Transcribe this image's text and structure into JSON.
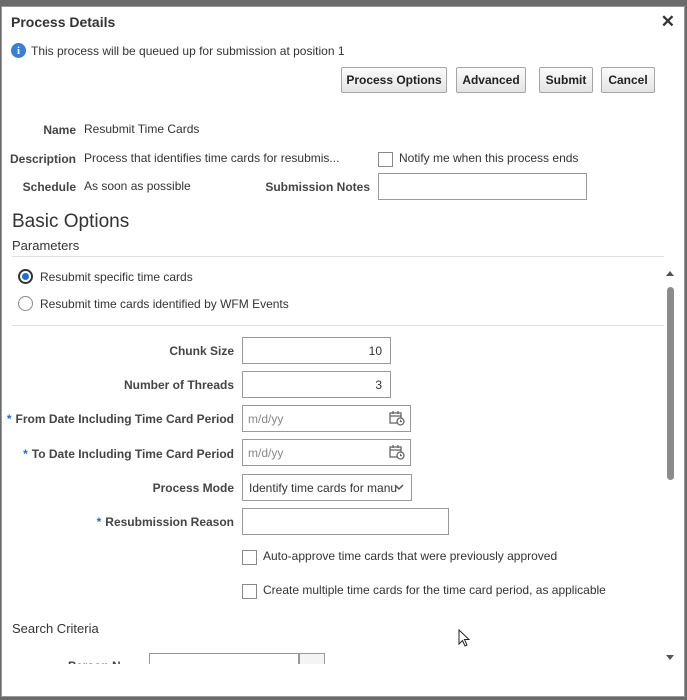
{
  "dialog": {
    "title": "Process Details",
    "close_glyph": "✕"
  },
  "info": {
    "icon_glyph": "i",
    "message": "This process will be queued up for submission at position 1"
  },
  "buttons": {
    "process_options": "Process Options",
    "advanced": "Advanced",
    "submit": "Submit",
    "cancel": "Cancel"
  },
  "details": {
    "name_label": "Name",
    "name_value": "Resubmit Time Cards",
    "description_label": "Description",
    "description_value": "Process that identifies time cards for resubmis...",
    "notify_label": "Notify me when this process ends",
    "schedule_label": "Schedule",
    "schedule_value": "As soon as possible",
    "submission_notes_label": "Submission Notes",
    "submission_notes_value": ""
  },
  "basic_options": {
    "heading": "Basic Options",
    "parameters_heading": "Parameters",
    "radios": [
      {
        "label": "Resubmit specific time cards",
        "selected": true
      },
      {
        "label": "Resubmit time cards identified by WFM Events",
        "selected": false
      }
    ]
  },
  "fields": {
    "chunk_size_label": "Chunk Size",
    "chunk_size_value": "10",
    "threads_label": "Number of Threads",
    "threads_value": "3",
    "from_date_label": "From Date Including Time Card Period",
    "from_date_placeholder": "m/d/yy",
    "to_date_label": "To Date Including Time Card Period",
    "to_date_placeholder": "m/d/yy",
    "process_mode_label": "Process Mode",
    "process_mode_value": "Identify time cards for manu",
    "reason_label": "Resubmission Reason",
    "reason_value": "",
    "auto_approve_label": "Auto-approve time cards that were previously approved",
    "multiple_label": "Create multiple time cards for the time card period, as applicable",
    "required_marker": "*"
  },
  "search_criteria": {
    "heading": "Search Criteria",
    "partial_label": "Person N"
  },
  "colors": {
    "accent": "#1b6fd1",
    "info": "#3a7fd5",
    "scroll_thumb": "#8c8c8c"
  },
  "icons": [
    "close-icon",
    "info-icon",
    "calendar-icon",
    "chevron-down-icon",
    "scroll-up-arrow-icon",
    "scroll-down-arrow-icon",
    "mouse-cursor-icon"
  ]
}
